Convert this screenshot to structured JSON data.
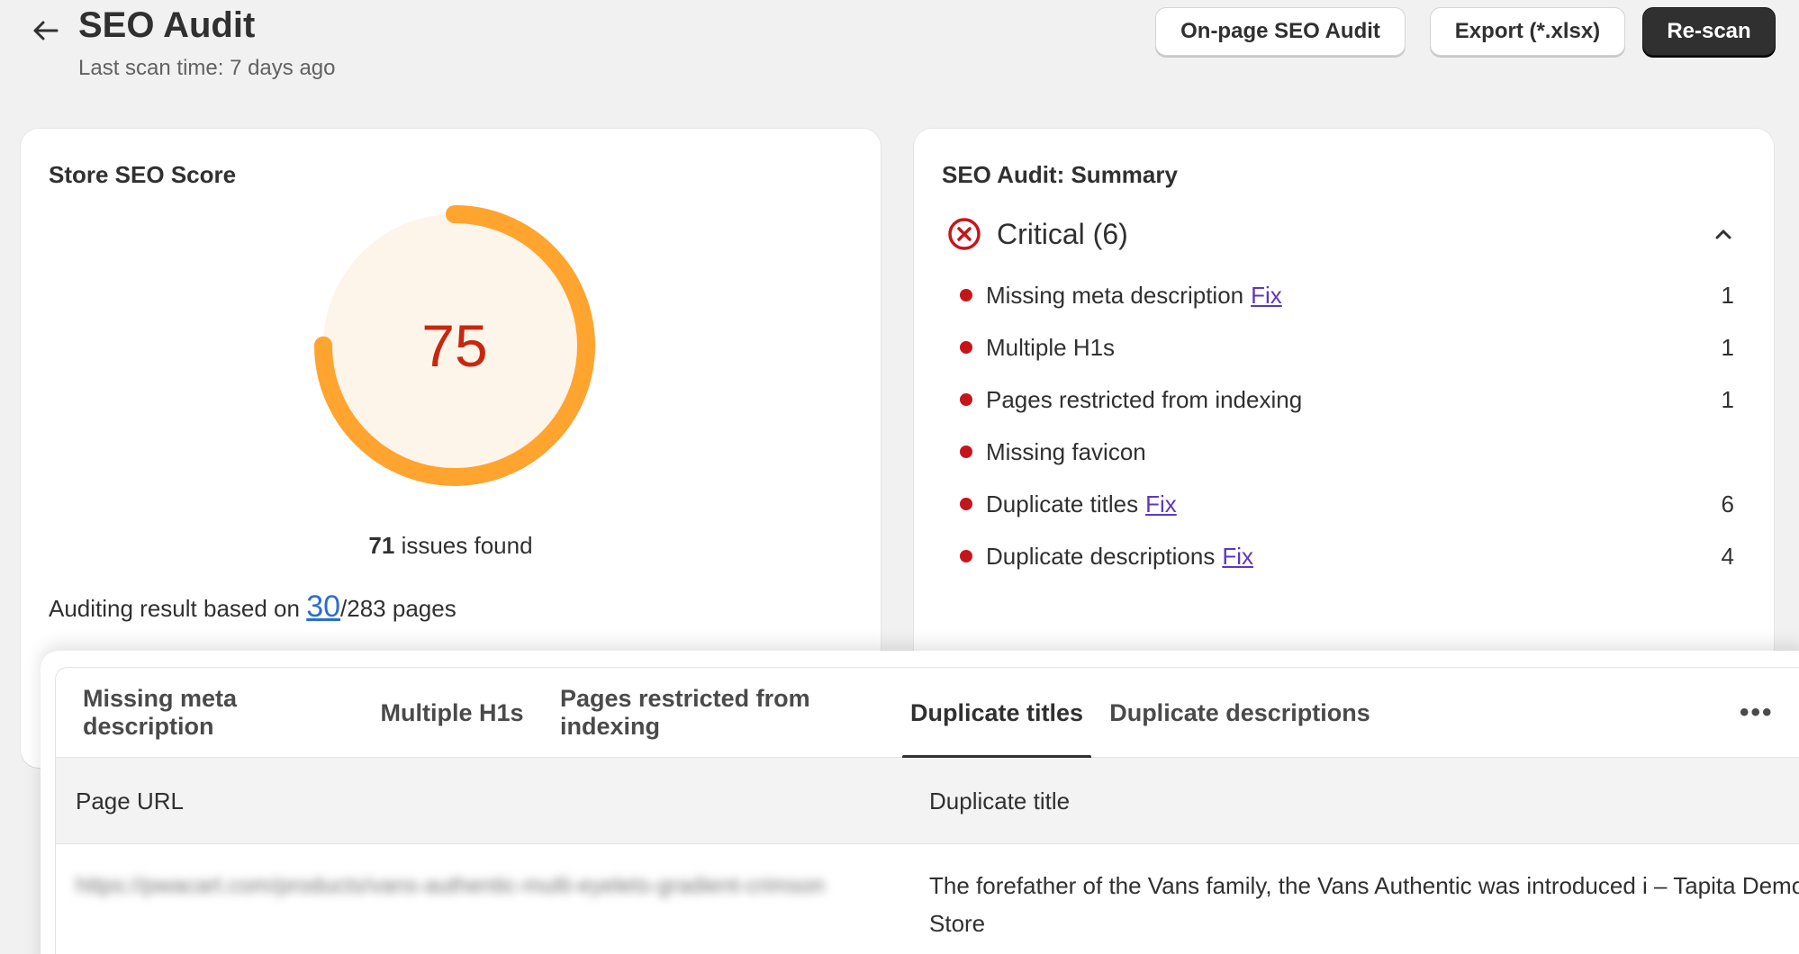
{
  "header": {
    "title": "SEO Audit",
    "subtitle": "Last scan time: 7 days ago",
    "buttons": {
      "onpage": "On-page SEO Audit",
      "export": "Export (*.xlsx)",
      "rescan": "Re-scan"
    }
  },
  "score_card": {
    "title": "Store SEO Score",
    "score": "75",
    "score_fraction": 0.75,
    "gauge_color": "#ffa42e",
    "issues_count": "71",
    "issues_text": " issues found",
    "audit_prefix": "Auditing result based on ",
    "audit_link": "30",
    "audit_suffix": "/283 pages"
  },
  "summary_card": {
    "title": "SEO Audit: Summary",
    "critical_label": "Critical (6)",
    "fix_label": "Fix",
    "items": [
      {
        "label": "Missing meta description",
        "fix": true,
        "count": "1"
      },
      {
        "label": "Multiple H1s",
        "fix": false,
        "count": "1"
      },
      {
        "label": "Pages restricted from indexing",
        "fix": false,
        "count": "1"
      },
      {
        "label": "Missing favicon",
        "fix": false,
        "count": ""
      },
      {
        "label": "Duplicate titles",
        "fix": true,
        "count": "6"
      },
      {
        "label": "Duplicate descriptions",
        "fix": true,
        "count": "4"
      }
    ]
  },
  "panel": {
    "tabs": [
      {
        "label": "Missing meta description",
        "active": false
      },
      {
        "label": "Multiple H1s",
        "active": false
      },
      {
        "label": "Pages restricted from indexing",
        "active": false
      },
      {
        "label": "Duplicate titles",
        "active": true
      },
      {
        "label": "Duplicate descriptions",
        "active": false
      }
    ],
    "more": "•••",
    "columns": [
      "Page URL",
      "Duplicate title"
    ],
    "rows": [
      {
        "url": "https://pwacart.com/products/vans-authentic-multi-eyelets-gradient-crimson",
        "title": "The forefather of the Vans family, the Vans Authentic was introduced i – Tapita Demo Store"
      }
    ]
  },
  "colors": {
    "critical": "#c5151b",
    "score_text": "#c6280f",
    "link": "#2c6ecb",
    "fix_link": "#5e37c0"
  }
}
